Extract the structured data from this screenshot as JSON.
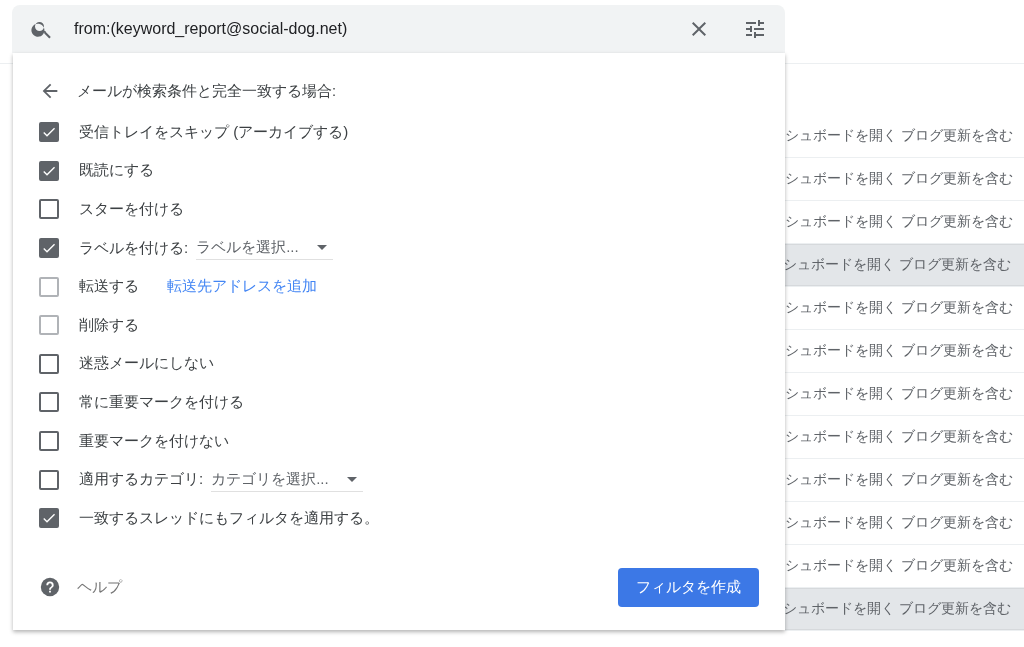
{
  "search": {
    "value": "from:(keyword_report@social-dog.net)"
  },
  "mail_rows": [
    {
      "snippet": "シュボードを開く ブログ更新を含む",
      "highlighted": false
    },
    {
      "snippet": "シュボードを開く ブログ更新を含む",
      "highlighted": false
    },
    {
      "snippet": "シュボードを開く ブログ更新を含む",
      "highlighted": false
    },
    {
      "snippet": "シュボードを開く ブログ更新を含む",
      "highlighted": true
    },
    {
      "snippet": "シュボードを開く ブログ更新を含む",
      "highlighted": false
    },
    {
      "snippet": "シュボードを開く ブログ更新を含む",
      "highlighted": false
    },
    {
      "snippet": "シュボードを開く ブログ更新を含む",
      "highlighted": false
    },
    {
      "snippet": "シュボードを開く ブログ更新を含む",
      "highlighted": false
    },
    {
      "snippet": "シュボードを開く ブログ更新を含む",
      "highlighted": false
    },
    {
      "snippet": "シュボードを開く ブログ更新を含む",
      "highlighted": false
    },
    {
      "snippet": "シュボードを開く ブログ更新を含む",
      "highlighted": false
    },
    {
      "snippet": "シュボードを開く ブログ更新を含む",
      "highlighted": true
    }
  ],
  "filter": {
    "heading": "メールが検索条件と完全一致する場合:",
    "options": [
      {
        "kind": "plain",
        "label": "受信トレイをスキップ (アーカイブする)",
        "checked": true,
        "disabled": false
      },
      {
        "kind": "plain",
        "label": "既読にする",
        "checked": true,
        "disabled": false
      },
      {
        "kind": "plain",
        "label": "スターを付ける",
        "checked": false,
        "disabled": false
      },
      {
        "kind": "dropdown",
        "label": "ラベルを付ける:",
        "choice": "ラベルを選択...",
        "checked": true,
        "disabled": false
      },
      {
        "kind": "link",
        "label": "転送する",
        "link": "転送先アドレスを追加",
        "checked": false,
        "disabled": true
      },
      {
        "kind": "plain",
        "label": "削除する",
        "checked": false,
        "disabled": true
      },
      {
        "kind": "plain",
        "label": "迷惑メールにしない",
        "checked": false,
        "disabled": false
      },
      {
        "kind": "plain",
        "label": "常に重要マークを付ける",
        "checked": false,
        "disabled": false
      },
      {
        "kind": "plain",
        "label": "重要マークを付けない",
        "checked": false,
        "disabled": false
      },
      {
        "kind": "dropdown",
        "label": "適用するカテゴリ:",
        "choice": "カテゴリを選択...",
        "checked": false,
        "disabled": false
      },
      {
        "kind": "plain",
        "label": "一致するスレッドにもフィルタを適用する。",
        "checked": true,
        "disabled": false
      }
    ],
    "help": "ヘルプ",
    "create_button": "フィルタを作成"
  }
}
